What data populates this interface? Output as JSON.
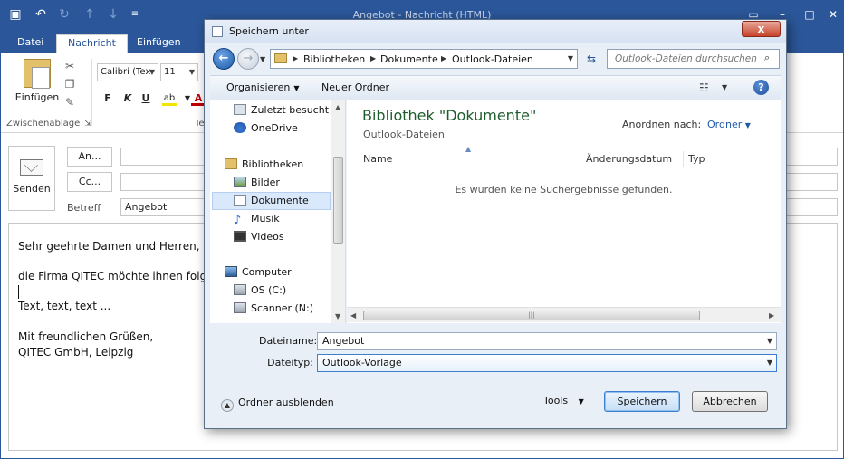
{
  "outlook": {
    "window_title": "Angebot - Nachricht (HTML)",
    "tabs": [
      "Datei",
      "Nachricht",
      "Einfügen"
    ],
    "ribbon": {
      "paste_label": "Einfügen",
      "clipboard_group": "Zwischenablage",
      "font_name": "Calibri (Tex",
      "font_size": "11",
      "format_buttons": [
        "F",
        "K",
        "U"
      ],
      "text_group": "Te"
    },
    "compose": {
      "send_label": "Senden",
      "to_label": "An...",
      "cc_label": "Cc...",
      "subject_label": "Betreff",
      "subject_value": "Angebot"
    },
    "body_lines": [
      "Sehr geehrte Damen und Herren,",
      "die Firma QITEC möchte ihnen folgen",
      "Text, text, text ...",
      "Mit freundlichen Grüßen,",
      "QITEC GmbH, Leipzig"
    ]
  },
  "dialog": {
    "title": "Speichern unter",
    "close_glyph": "x",
    "breadcrumbs": [
      "Bibliotheken",
      "Dokumente",
      "Outlook-Dateien"
    ],
    "search_placeholder": "Outlook-Dateien durchsuchen",
    "toolbar": {
      "organize": "Organisieren",
      "new_folder": "Neuer Ordner"
    },
    "nav_items": [
      {
        "label": "Zuletzt besucht",
        "icon": "recent-places-icon"
      },
      {
        "label": "OneDrive",
        "icon": "onedrive-icon"
      },
      {
        "label": "Bibliotheken",
        "icon": "libraries-icon"
      },
      {
        "label": "Bilder",
        "icon": "pictures-icon"
      },
      {
        "label": "Dokumente",
        "icon": "documents-icon"
      },
      {
        "label": "Musik",
        "icon": "music-icon"
      },
      {
        "label": "Videos",
        "icon": "videos-icon"
      },
      {
        "label": "Computer",
        "icon": "computer-icon"
      },
      {
        "label": "OS (C:)",
        "icon": "drive-icon"
      },
      {
        "label": "Scanner (N:)",
        "icon": "network-drive-icon"
      }
    ],
    "content": {
      "library_title": "Bibliothek \"Dokumente\"",
      "library_subtitle": "Outlook-Dateien",
      "arrange_label": "Anordnen nach:",
      "arrange_value": "Ordner",
      "columns": [
        "Name",
        "Änderungsdatum",
        "Typ"
      ],
      "empty_message": "Es wurden keine Suchergebnisse gefunden."
    },
    "filename_label": "Dateiname:",
    "filename_value": "Angebot",
    "filetype_label": "Dateityp:",
    "filetype_value": "Outlook-Vorlage",
    "hide_folders": "Ordner ausblenden",
    "tools": "Tools",
    "save": "Speichern",
    "cancel": "Abbrechen"
  },
  "colors": {
    "outlook_blue": "#2b579a",
    "library_title_green": "#1e5e2e",
    "dialog_bg": "#e9eff7"
  }
}
